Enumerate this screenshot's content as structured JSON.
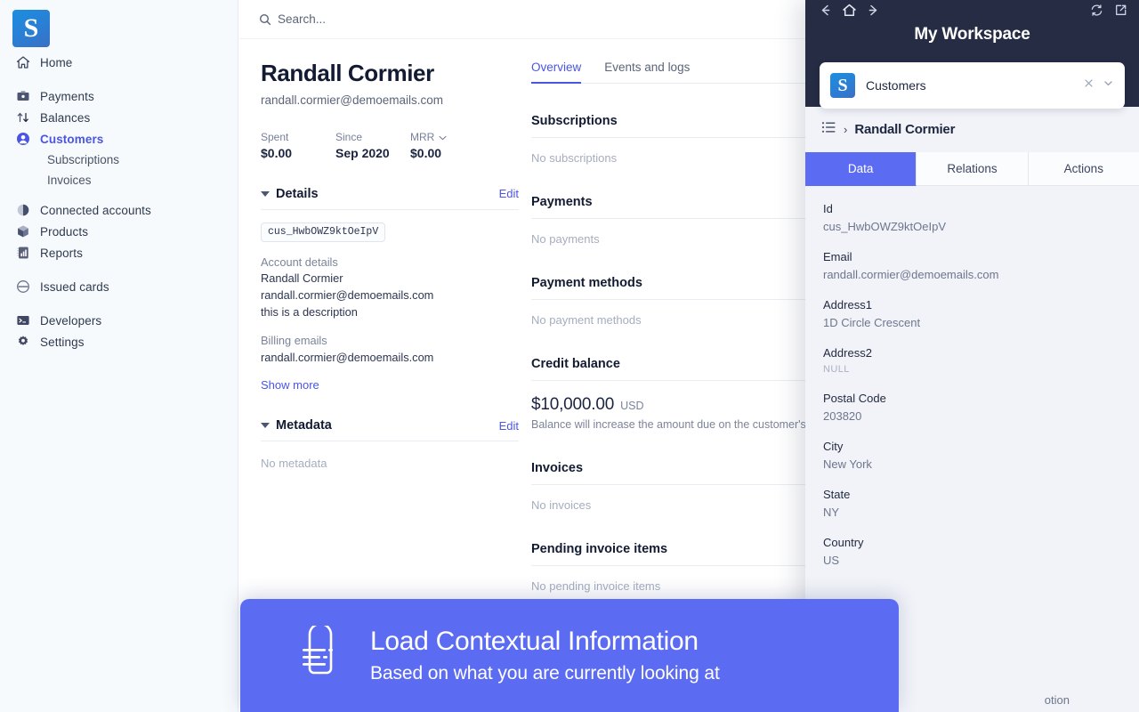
{
  "brand": {
    "logo_letter": "S",
    "accent": "#4a56e2",
    "panel_accent": "#5c6cf2",
    "panel_header_bg": "#252c44"
  },
  "sidebar": {
    "items": [
      {
        "label": "Home",
        "icon": "home-icon",
        "type": "item"
      },
      {
        "label": "Payments",
        "icon": "payments-icon",
        "type": "item"
      },
      {
        "label": "Balances",
        "icon": "balances-icon",
        "type": "item"
      },
      {
        "label": "Customers",
        "icon": "customers-icon",
        "type": "item",
        "active": true
      },
      {
        "label": "Subscriptions",
        "type": "sub"
      },
      {
        "label": "Invoices",
        "type": "sub"
      },
      {
        "label": "Connected accounts",
        "icon": "connected-accounts-icon",
        "type": "item"
      },
      {
        "label": "Products",
        "icon": "products-icon",
        "type": "item"
      },
      {
        "label": "Reports",
        "icon": "reports-icon",
        "type": "item"
      },
      {
        "label": "Issued cards",
        "icon": "issued-cards-icon",
        "type": "item"
      },
      {
        "label": "Developers",
        "icon": "developers-icon",
        "type": "item"
      },
      {
        "label": "Settings",
        "icon": "settings-icon",
        "type": "item"
      }
    ]
  },
  "topbar": {
    "search_placeholder": "Search..."
  },
  "customer": {
    "name": "Randall Cormier",
    "email": "randall.cormier@demoemails.com",
    "stats": [
      {
        "label": "Spent",
        "value": "$0.00"
      },
      {
        "label": "Since",
        "value": "Sep 2020"
      },
      {
        "label": "MRR",
        "value": "$0.00",
        "has_dropdown": true
      }
    ],
    "details": {
      "title": "Details",
      "edit_label": "Edit",
      "id_chip": "cus_HwbOWZ9ktOeIpV",
      "groups": [
        {
          "label": "Account details",
          "values": [
            "Randall Cormier",
            "randall.cormier@demoemails.com",
            "this is a description"
          ]
        },
        {
          "label": "Billing emails",
          "values": [
            "randall.cormier@demoemails.com"
          ]
        }
      ],
      "show_more_label": "Show more"
    },
    "metadata": {
      "title": "Metadata",
      "edit_label": "Edit",
      "empty": "No metadata"
    }
  },
  "overview": {
    "tabs": [
      {
        "label": "Overview",
        "active": true
      },
      {
        "label": "Events and logs",
        "active": false
      }
    ],
    "sections": [
      {
        "title": "Subscriptions",
        "empty": "No subscriptions"
      },
      {
        "title": "Payments",
        "empty": "No payments"
      },
      {
        "title": "Payment methods",
        "empty": "No payment methods"
      }
    ],
    "credit_balance": {
      "title": "Credit balance",
      "amount": "$10,000.00",
      "currency": "USD",
      "note": "Balance will increase the amount due on the customer's n"
    },
    "sections_after": [
      {
        "title": "Invoices",
        "empty": "No invoices"
      },
      {
        "title": "Pending invoice items",
        "empty": "No pending invoice items"
      }
    ]
  },
  "panel": {
    "title": "My Workspace",
    "nav_icons": [
      "back-arrow-icon",
      "home-icon",
      "forward-arrow-icon"
    ],
    "tool_icons": [
      "refresh-icon",
      "external-link-icon"
    ],
    "app_card": {
      "logo_letter": "S",
      "name": "Customers",
      "actions": [
        "close-icon",
        "chevron-down-icon"
      ]
    },
    "breadcrumb": {
      "list_icon": "list-icon",
      "separator": "›",
      "text": "Randall Cormier"
    },
    "tabs": [
      {
        "label": "Data",
        "active": true
      },
      {
        "label": "Relations",
        "active": false
      },
      {
        "label": "Actions",
        "active": false
      }
    ],
    "fields": [
      {
        "key": "Id",
        "value": "cus_HwbOWZ9ktOeIpV"
      },
      {
        "key": "Email",
        "value": "randall.cormier@demoemails.com"
      },
      {
        "key": "Address1",
        "value": "1D Circle Crescent"
      },
      {
        "key": "Address2",
        "value": "NULL",
        "is_null": true
      },
      {
        "key": "Postal Code",
        "value": "203820"
      },
      {
        "key": "City",
        "value": "New York"
      },
      {
        "key": "State",
        "value": "NY"
      },
      {
        "key": "Country",
        "value": "US"
      }
    ],
    "partial_field_text": "otion"
  },
  "banner": {
    "icon": "document-lines-icon",
    "title": "Load Contextual Information",
    "subtitle": "Based on what you are currently looking at"
  }
}
